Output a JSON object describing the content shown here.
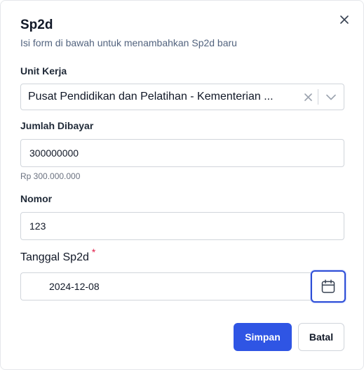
{
  "dialog": {
    "title": "Sp2d",
    "subtitle": "Isi form di bawah untuk menambahkan Sp2d baru"
  },
  "fields": {
    "unit_kerja": {
      "label": "Unit Kerja",
      "value": "Pusat Pendidikan dan Pelatihan - Kementerian ..."
    },
    "jumlah_dibayar": {
      "label": "Jumlah Dibayar",
      "value": "300000000",
      "helper": "Rp 300.000.000"
    },
    "nomor": {
      "label": "Nomor",
      "value": "123"
    },
    "tanggal": {
      "label": "Tanggal Sp2d",
      "required_mark": "*",
      "value": "2024-12-08"
    }
  },
  "actions": {
    "save_label": "Simpan",
    "cancel_label": "Batal"
  },
  "icons": {
    "close": "close-icon",
    "clear": "clear-icon",
    "chevron": "chevron-down-icon",
    "calendar": "calendar-icon"
  },
  "colors": {
    "primary": "#2f55e4",
    "subtitle": "#52637e",
    "required": "#e11d48",
    "focus_ring": "#2f4fd6"
  }
}
